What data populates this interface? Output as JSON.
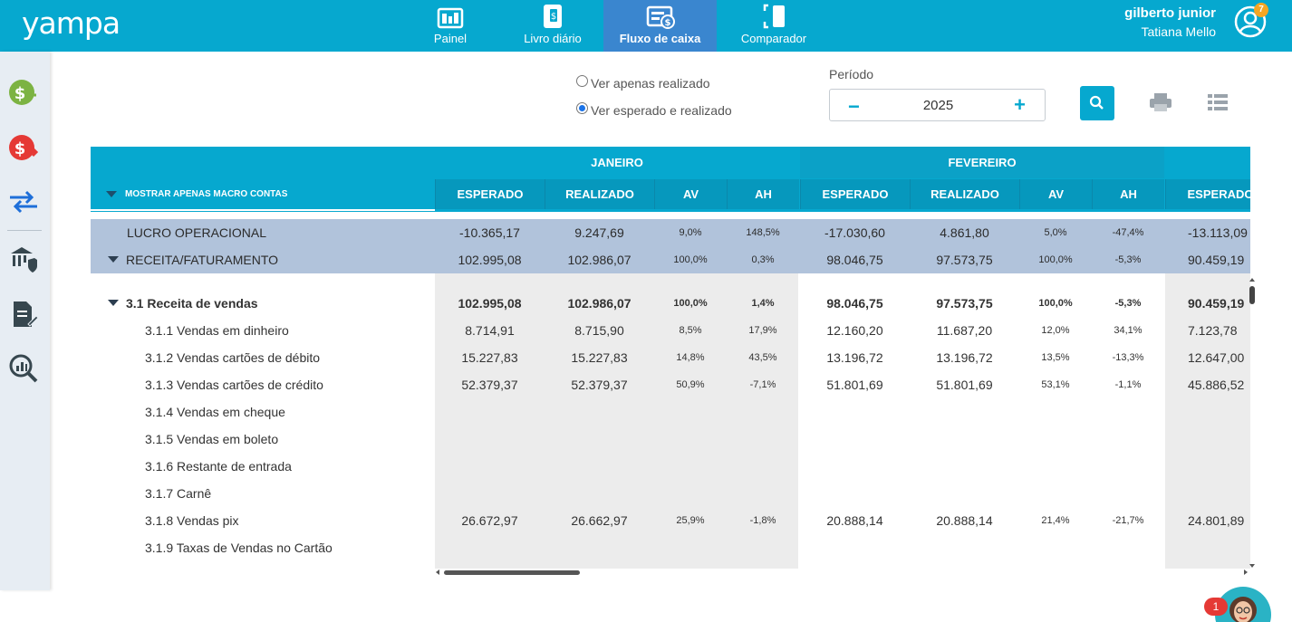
{
  "app": {
    "logo": "yampa"
  },
  "nav": [
    {
      "label": "Painel",
      "icon": "dashboard-icon",
      "active": false
    },
    {
      "label": "Livro diário",
      "icon": "ledger-book-icon",
      "active": false
    },
    {
      "label": "Fluxo de caixa",
      "icon": "cashflow-icon",
      "active": true
    },
    {
      "label": "Comparador",
      "icon": "compare-icon",
      "active": false
    }
  ],
  "user": {
    "name": "gilberto junior",
    "company": "Tatiana Mello",
    "notifications": "7"
  },
  "sidebar": [
    {
      "icon": "money-in-icon",
      "color": "#7cb342"
    },
    {
      "icon": "money-out-icon",
      "color": "#e53935"
    },
    {
      "icon": "transfer-icon",
      "color": "#1e6fd9"
    },
    {
      "icon": "bank-secure-icon",
      "color": "#37474f"
    },
    {
      "icon": "document-edit-icon",
      "color": "#37474f"
    },
    {
      "icon": "analytics-search-icon",
      "color": "#37474f"
    }
  ],
  "filters": {
    "option_realizado": "Ver apenas realizado",
    "option_esperado": "Ver esperado e realizado",
    "selected": "esperado",
    "period_label": "Período",
    "period_value": "2025"
  },
  "table": {
    "macro_label": "MOSTRAR APENAS MACRO CONTAS",
    "months": [
      "JANEIRO",
      "FEVEREIRO"
    ],
    "sub_columns": [
      "ESPERADO",
      "REALIZADO",
      "AV",
      "AH",
      "ESPERADO",
      "REALIZADO",
      "AV",
      "AH",
      "ESPERADO"
    ],
    "rows": [
      {
        "label": "LUCRO OPERACIONAL",
        "kind": "summary",
        "values": [
          "-10.365,17",
          "9.247,69",
          "9,0%",
          "148,5%",
          "-17.030,60",
          "4.861,80",
          "5,0%",
          "-47,4%",
          "-13.113,09"
        ]
      },
      {
        "label": "RECEITA/FATURAMENTO",
        "kind": "summary-toggle",
        "values": [
          "102.995,08",
          "102.986,07",
          "100,0%",
          "0,3%",
          "98.046,75",
          "97.573,75",
          "100,0%",
          "-5,3%",
          "90.459,19"
        ]
      },
      {
        "label": "3.1 Receita de vendas",
        "kind": "group",
        "values": [
          "102.995,08",
          "102.986,07",
          "100,0%",
          "1,4%",
          "98.046,75",
          "97.573,75",
          "100,0%",
          "-5,3%",
          "90.459,19"
        ]
      },
      {
        "label": "3.1.1 Vendas em dinheiro",
        "kind": "item",
        "values": [
          "8.714,91",
          "8.715,90",
          "8,5%",
          "17,9%",
          "12.160,20",
          "11.687,20",
          "12,0%",
          "34,1%",
          "7.123,78"
        ]
      },
      {
        "label": "3.1.2 Vendas cartões de débito",
        "kind": "item",
        "values": [
          "15.227,83",
          "15.227,83",
          "14,8%",
          "43,5%",
          "13.196,72",
          "13.196,72",
          "13,5%",
          "-13,3%",
          "12.647,00"
        ]
      },
      {
        "label": "3.1.3 Vendas cartões de crédito",
        "kind": "item",
        "values": [
          "52.379,37",
          "52.379,37",
          "50,9%",
          "-7,1%",
          "51.801,69",
          "51.801,69",
          "53,1%",
          "-1,1%",
          "45.886,52"
        ]
      },
      {
        "label": "3.1.4 Vendas em cheque",
        "kind": "item",
        "values": [
          "",
          "",
          "",
          "",
          "",
          "",
          "",
          "",
          ""
        ]
      },
      {
        "label": "3.1.5 Vendas em boleto",
        "kind": "item",
        "values": [
          "",
          "",
          "",
          "",
          "",
          "",
          "",
          "",
          ""
        ]
      },
      {
        "label": "3.1.6 Restante de entrada",
        "kind": "item",
        "values": [
          "",
          "",
          "",
          "",
          "",
          "",
          "",
          "",
          ""
        ]
      },
      {
        "label": "3.1.7 Carnê",
        "kind": "item",
        "values": [
          "",
          "",
          "",
          "",
          "",
          "",
          "",
          "",
          ""
        ]
      },
      {
        "label": "3.1.8 Vendas pix",
        "kind": "item",
        "values": [
          "26.672,97",
          "26.662,97",
          "25,9%",
          "-1,8%",
          "20.888,14",
          "20.888,14",
          "21,4%",
          "-21,7%",
          "24.801,89"
        ]
      },
      {
        "label": "3.1.9 Taxas de Vendas no Cartão",
        "kind": "item",
        "values": [
          "",
          "",
          "",
          "",
          "",
          "",
          "",
          "",
          ""
        ]
      }
    ]
  },
  "chat": {
    "badge": "1"
  },
  "colors": {
    "primary": "#06a8cf",
    "active_tab": "#3a86cf",
    "summary_row": "#b1c3db"
  }
}
